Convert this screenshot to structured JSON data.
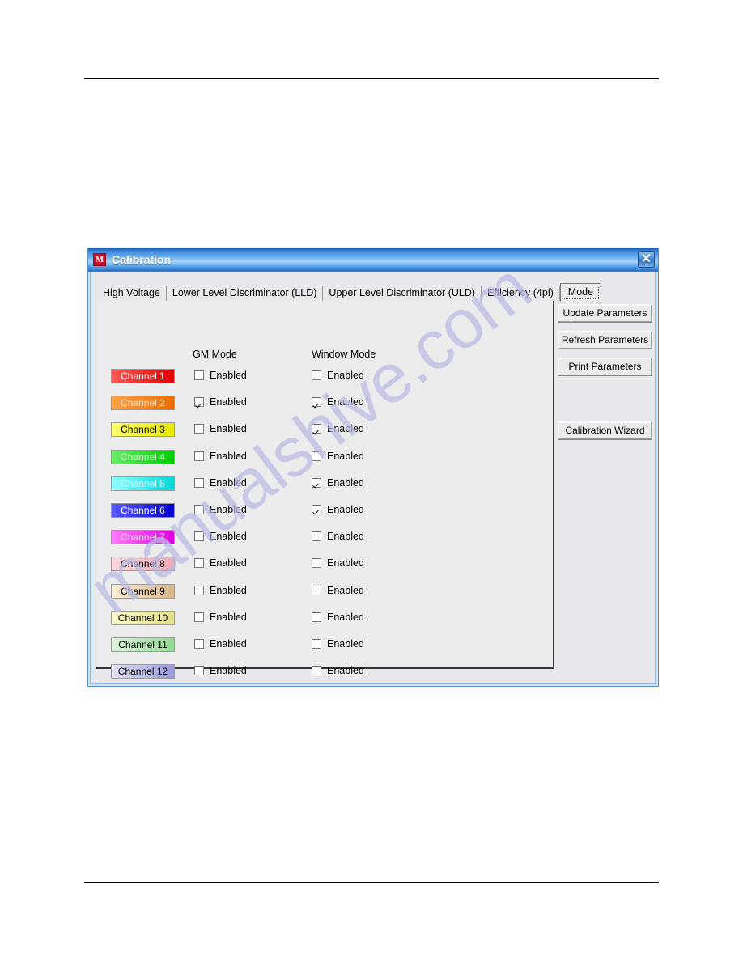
{
  "document": {
    "header_rule": true,
    "footer_rule": true,
    "watermark": "manualshive.com"
  },
  "dialog": {
    "title": "Calibration",
    "icon": "app-icon-m",
    "close_label": "✕",
    "accent_color": "#3e89de",
    "tabs": [
      {
        "label": "High Voltage",
        "selected": false
      },
      {
        "label": "Lower Level Discriminator (LLD)",
        "selected": false
      },
      {
        "label": "Upper Level Discriminator (ULD)",
        "selected": false
      },
      {
        "label": "Efficiency (4pi)",
        "selected": false
      },
      {
        "label": "Mode",
        "selected": true
      }
    ],
    "columns": {
      "gm_mode": "GM Mode",
      "window_mode": "Window Mode"
    },
    "checkbox_label": "Enabled",
    "channels": [
      {
        "label": "Channel 1",
        "color_from": "#ff5a5a",
        "color_to": "#e00000",
        "text_color": "#ffffff",
        "gm_enabled": false,
        "window_enabled": false
      },
      {
        "label": "Channel 2",
        "color_from": "#ffa24a",
        "color_to": "#ef6b00",
        "text_color": "#ffe7c8",
        "gm_enabled": true,
        "window_enabled": true
      },
      {
        "label": "Channel 3",
        "color_from": "#ffff70",
        "color_to": "#e8e800",
        "text_color": "#000000",
        "gm_enabled": false,
        "window_enabled": true
      },
      {
        "label": "Channel 4",
        "color_from": "#66ee66",
        "color_to": "#00cc00",
        "text_color": "#d8ffd8",
        "gm_enabled": false,
        "window_enabled": false
      },
      {
        "label": "Channel 5",
        "color_from": "#8fffff",
        "color_to": "#00d8d8",
        "text_color": "#d4ffff",
        "gm_enabled": false,
        "window_enabled": true
      },
      {
        "label": "Channel 6",
        "color_from": "#5a5aff",
        "color_to": "#0000cc",
        "text_color": "#ffffff",
        "gm_enabled": false,
        "window_enabled": true
      },
      {
        "label": "Channel 7",
        "color_from": "#ff7aff",
        "color_to": "#e000e0",
        "text_color": "#ffd8ff",
        "gm_enabled": false,
        "window_enabled": false
      },
      {
        "label": "Channel 8",
        "color_from": "#ffd8dc",
        "color_to": "#f0a8b4",
        "text_color": "#000000",
        "gm_enabled": false,
        "window_enabled": false
      },
      {
        "label": "Channel 9",
        "color_from": "#fbf0d8",
        "color_to": "#d8b488",
        "text_color": "#000000",
        "gm_enabled": false,
        "window_enabled": false
      },
      {
        "label": "Channel 10",
        "color_from": "#fbfbd0",
        "color_to": "#e2e08c",
        "text_color": "#000000",
        "gm_enabled": false,
        "window_enabled": false
      },
      {
        "label": "Channel 11",
        "color_from": "#dcf6dc",
        "color_to": "#92d892",
        "text_color": "#000000",
        "gm_enabled": false,
        "window_enabled": false
      },
      {
        "label": "Channel 12",
        "color_from": "#e2e2f6",
        "color_to": "#9a9ad8",
        "text_color": "#000000",
        "gm_enabled": false,
        "window_enabled": false
      }
    ],
    "actions": [
      {
        "label": "Update Parameters",
        "spaced": false
      },
      {
        "label": "Refresh Parameters",
        "spaced": false
      },
      {
        "label": "Print Parameters",
        "spaced": false
      },
      {
        "label": "Calibration Wizard",
        "spaced": true
      }
    ]
  }
}
